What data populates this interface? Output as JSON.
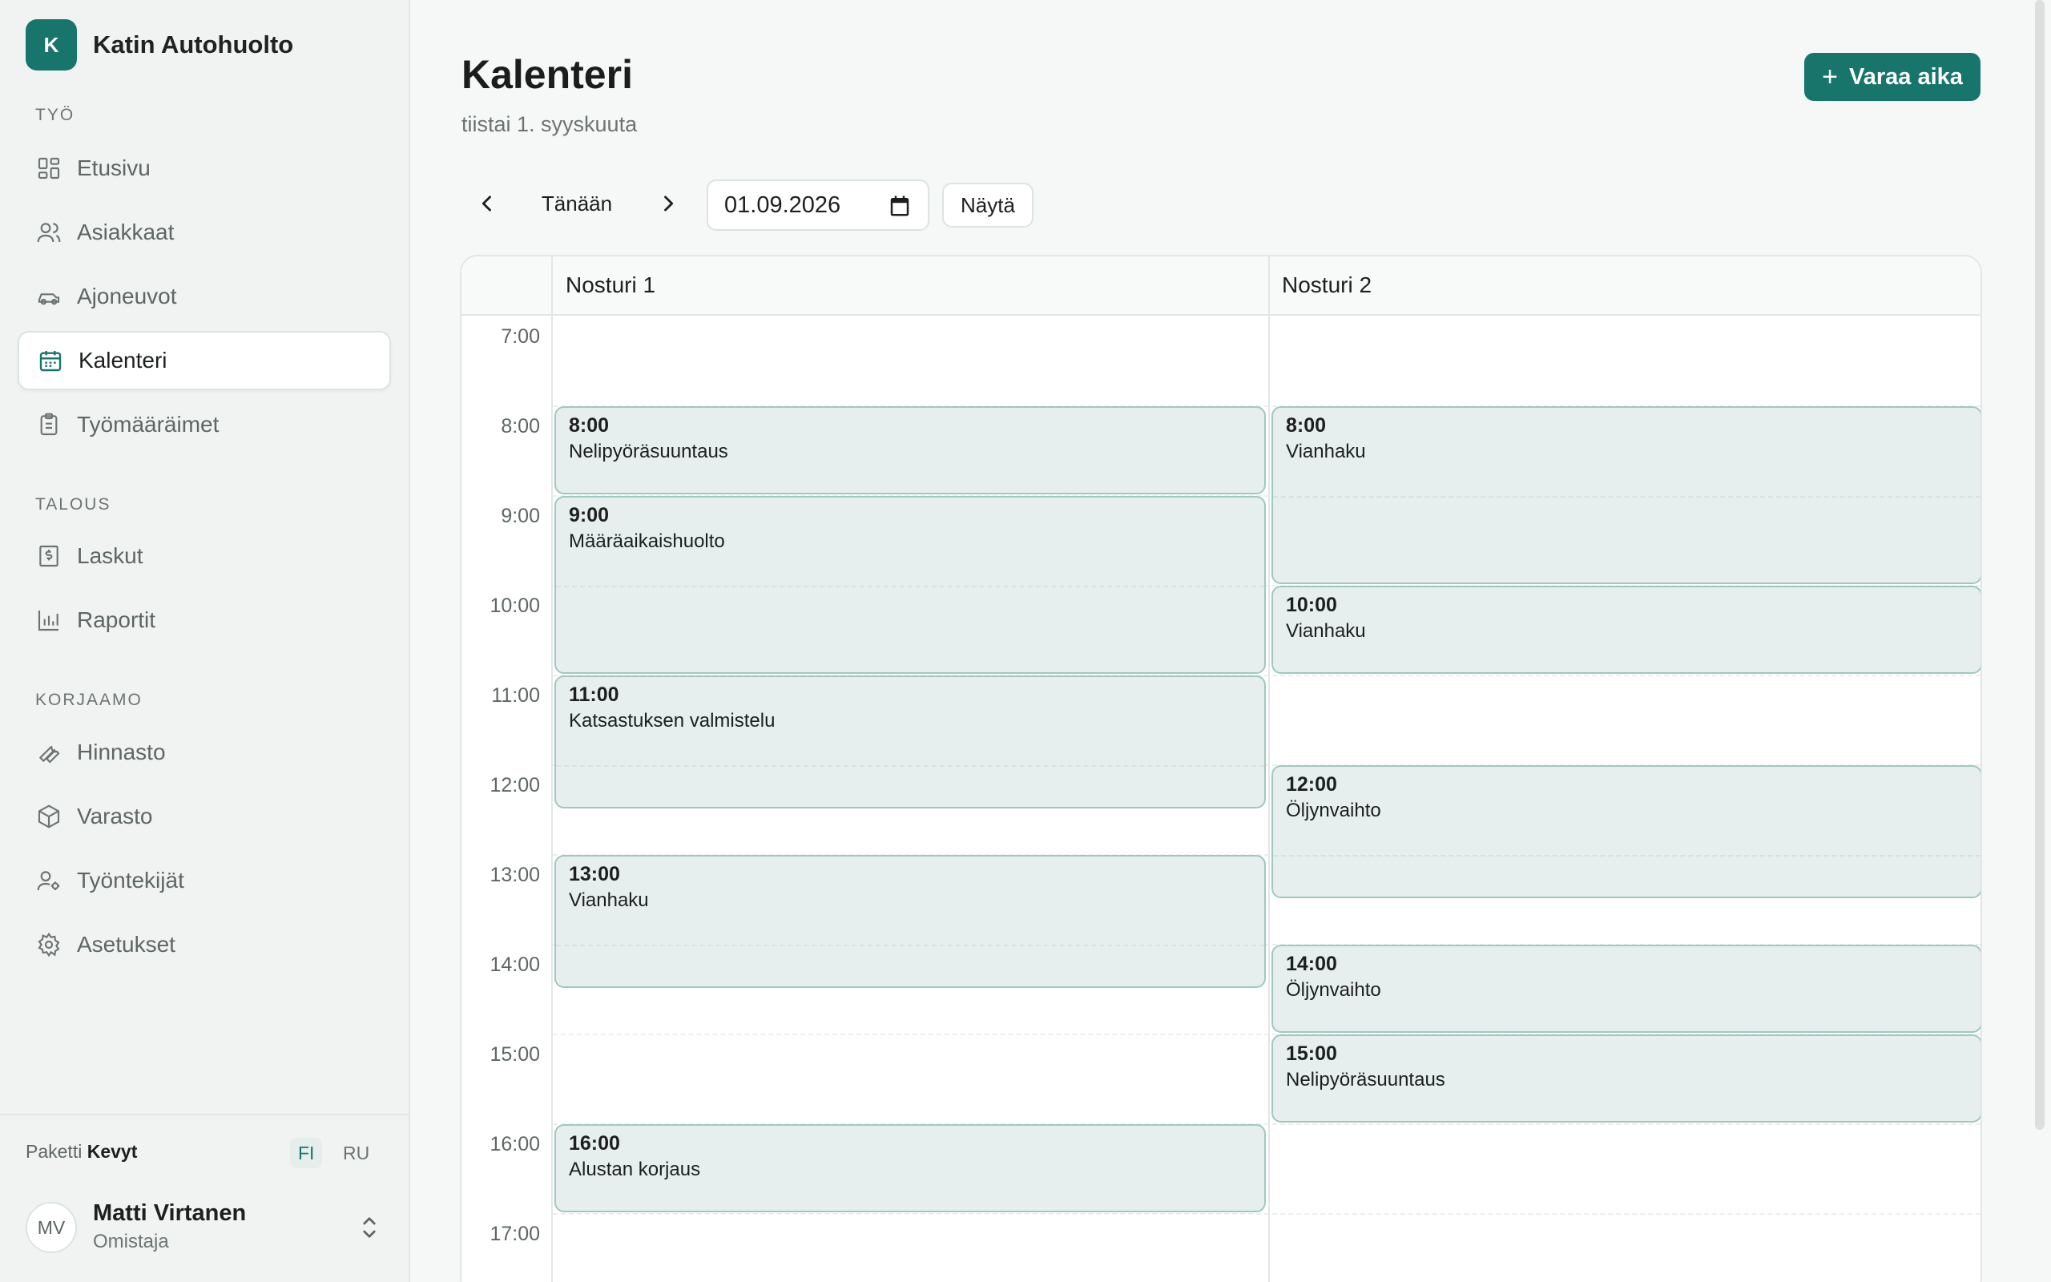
{
  "brand": {
    "initial": "K",
    "name": "Katin Autohuolto"
  },
  "sidebar": {
    "sections": [
      {
        "title": "TYÖ",
        "items": [
          {
            "label": "Etusivu",
            "icon": "dashboard-icon"
          },
          {
            "label": "Asiakkaat",
            "icon": "users-icon"
          },
          {
            "label": "Ajoneuvot",
            "icon": "car-icon"
          },
          {
            "label": "Kalenteri",
            "icon": "calendar-icon",
            "active": true
          },
          {
            "label": "Työmääräimet",
            "icon": "clipboard-icon"
          }
        ]
      },
      {
        "title": "TALOUS",
        "items": [
          {
            "label": "Laskut",
            "icon": "invoice-icon"
          },
          {
            "label": "Raportit",
            "icon": "bar-chart-icon"
          }
        ]
      },
      {
        "title": "KORJAAMO",
        "items": [
          {
            "label": "Hinnasto",
            "icon": "wrench-icon"
          },
          {
            "label": "Varasto",
            "icon": "box-icon"
          },
          {
            "label": "Työntekijät",
            "icon": "user-settings-icon"
          },
          {
            "label": "Asetukset",
            "icon": "gear-icon"
          }
        ]
      }
    ]
  },
  "footer": {
    "plan_label": "Paketti",
    "plan_name": "Kevyt",
    "languages": [
      "FI",
      "RU"
    ],
    "active_language": "FI",
    "user": {
      "initials": "MV",
      "name": "Matti Virtanen",
      "role": "Omistaja"
    }
  },
  "header": {
    "title": "Kalenteri",
    "subtitle": "tiistai 1. syyskuuta",
    "book_button": "Varaa aika"
  },
  "toolbar": {
    "today": "Tänään",
    "date_value": "01.09.2026",
    "show": "Näytä"
  },
  "calendar": {
    "hours": [
      "7:00",
      "8:00",
      "9:00",
      "10:00",
      "11:00",
      "12:00",
      "13:00",
      "14:00",
      "15:00",
      "16:00",
      "17:00"
    ],
    "columns": [
      {
        "name": "Nosturi 1",
        "events": [
          {
            "time": "8:00",
            "title": "Nelipyöräsuuntaus",
            "start": 8.0,
            "end": 9.0
          },
          {
            "time": "9:00",
            "title": "Määräaikaishuolto",
            "start": 9.0,
            "end": 11.0
          },
          {
            "time": "11:00",
            "title": "Katsastuksen valmistelu",
            "start": 11.0,
            "end": 12.5
          },
          {
            "time": "13:00",
            "title": "Vianhaku",
            "start": 13.0,
            "end": 14.5
          },
          {
            "time": "16:00",
            "title": "Alustan korjaus",
            "start": 16.0,
            "end": 17.0
          }
        ]
      },
      {
        "name": "Nosturi 2",
        "events": [
          {
            "time": "8:00",
            "title": "Vianhaku",
            "start": 8.0,
            "end": 10.0
          },
          {
            "time": "10:00",
            "title": "Vianhaku",
            "start": 10.0,
            "end": 11.0
          },
          {
            "time": "12:00",
            "title": "Öljynvaihto",
            "start": 12.0,
            "end": 13.5
          },
          {
            "time": "14:00",
            "title": "Öljynvaihto",
            "start": 14.0,
            "end": 15.0
          },
          {
            "time": "15:00",
            "title": "Nelipyöräsuuntaus",
            "start": 15.0,
            "end": 16.0
          }
        ]
      }
    ]
  },
  "colors": {
    "accent": "#17756b",
    "event_bg": "#e6efee",
    "event_border": "#9fc8c1"
  }
}
